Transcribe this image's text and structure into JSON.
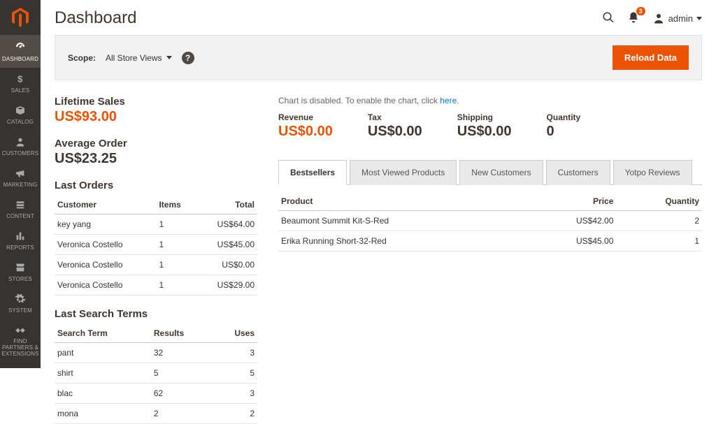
{
  "page_title": "Dashboard",
  "colors": {
    "accent": "#eb5202",
    "sidebar_bg": "#373330"
  },
  "header": {
    "notifications_count": "3",
    "user_label": "admin"
  },
  "sidebar": {
    "items": [
      {
        "label": "DASHBOARD"
      },
      {
        "label": "SALES"
      },
      {
        "label": "CATALOG"
      },
      {
        "label": "CUSTOMERS"
      },
      {
        "label": "MARKETING"
      },
      {
        "label": "CONTENT"
      },
      {
        "label": "REPORTS"
      },
      {
        "label": "STORES"
      },
      {
        "label": "SYSTEM"
      },
      {
        "label": "FIND PARTNERS & EXTENSIONS"
      }
    ]
  },
  "scope": {
    "label": "Scope:",
    "selected": "All Store Views",
    "reload_label": "Reload Data"
  },
  "stats": {
    "lifetime_sales_label": "Lifetime Sales",
    "lifetime_sales_value": "US$93.00",
    "avg_order_label": "Average Order",
    "avg_order_value": "US$23.25"
  },
  "last_orders": {
    "title": "Last Orders",
    "columns": {
      "customer": "Customer",
      "items": "Items",
      "total": "Total"
    },
    "rows": [
      {
        "customer": "key yang",
        "items": "1",
        "total": "US$64.00"
      },
      {
        "customer": "Veronica Costello",
        "items": "1",
        "total": "US$45.00"
      },
      {
        "customer": "Veronica Costello",
        "items": "1",
        "total": "US$0.00"
      },
      {
        "customer": "Veronica Costello",
        "items": "1",
        "total": "US$29.00"
      }
    ]
  },
  "last_search": {
    "title": "Last Search Terms",
    "columns": {
      "term": "Search Term",
      "results": "Results",
      "uses": "Uses"
    },
    "rows": [
      {
        "term": "pant",
        "results": "32",
        "uses": "3"
      },
      {
        "term": "shirt",
        "results": "5",
        "uses": "5"
      },
      {
        "term": "blac",
        "results": "62",
        "uses": "3"
      },
      {
        "term": "mona",
        "results": "2",
        "uses": "2"
      }
    ]
  },
  "chart_notice": {
    "prefix": "Chart is disabled. To enable the chart, click ",
    "link_text": "here",
    "suffix": "."
  },
  "summary": {
    "revenue_label": "Revenue",
    "revenue_value": "US$0.00",
    "tax_label": "Tax",
    "tax_value": "US$0.00",
    "shipping_label": "Shipping",
    "shipping_value": "US$0.00",
    "quantity_label": "Quantity",
    "quantity_value": "0"
  },
  "tabs": {
    "items": [
      {
        "label": "Bestsellers"
      },
      {
        "label": "Most Viewed Products"
      },
      {
        "label": "New Customers"
      },
      {
        "label": "Customers"
      },
      {
        "label": "Yotpo Reviews"
      }
    ]
  },
  "bestsellers": {
    "columns": {
      "product": "Product",
      "price": "Price",
      "quantity": "Quantity"
    },
    "rows": [
      {
        "product": "Beaumont Summit Kit-S-Red",
        "price": "US$42.00",
        "quantity": "2"
      },
      {
        "product": "Erika Running Short-32-Red",
        "price": "US$45.00",
        "quantity": "1"
      }
    ]
  }
}
